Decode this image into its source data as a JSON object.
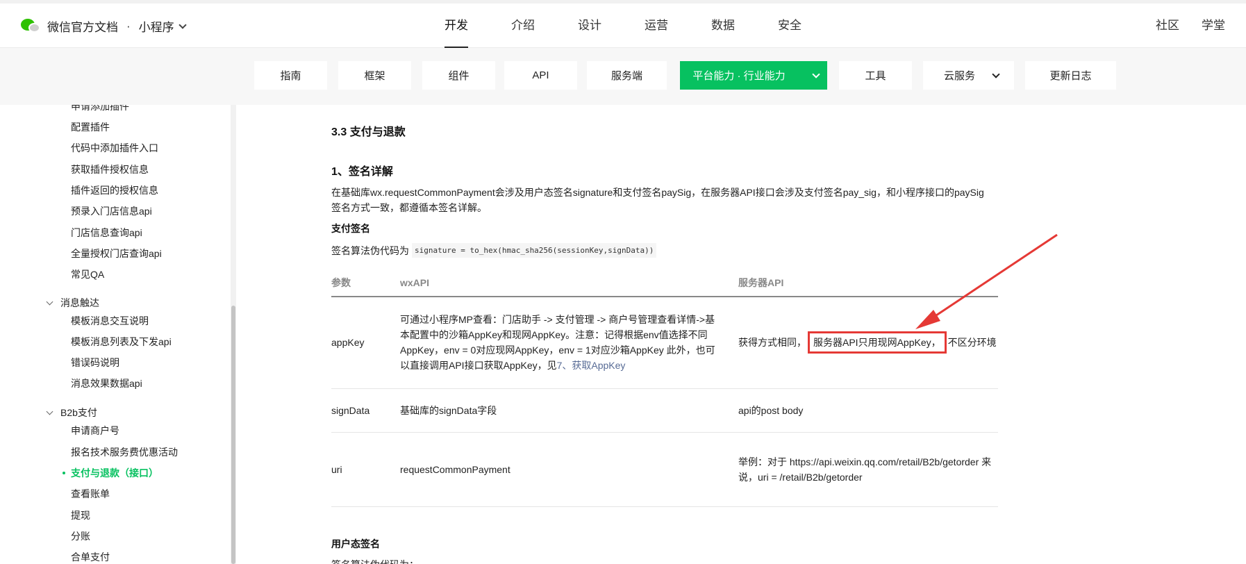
{
  "header": {
    "brand_title": "微信官方文档",
    "brand_dot": "·",
    "brand_sub": "小程序",
    "nav": [
      "开发",
      "介绍",
      "设计",
      "运营",
      "数据",
      "安全"
    ],
    "right_nav": [
      "社区",
      "学堂"
    ]
  },
  "subnav": {
    "tabs": [
      "指南",
      "框架",
      "组件",
      "API",
      "服务端",
      "平台能力 · 行业能力",
      "工具",
      "云服务",
      "更新日志"
    ],
    "active_tab": "平台能力 · 行业能力",
    "accent_color": "#07c160"
  },
  "sidebar": {
    "partial_top": "申请添加插件",
    "items_plugin": [
      "配置插件",
      "代码中添加插件入口",
      "获取插件授权信息",
      "插件返回的授权信息",
      "预录入门店信息api",
      "门店信息查询api",
      "全量授权门店查询api",
      "常见QA"
    ],
    "group_msg": "消息触达",
    "items_msg": [
      "模板消息交互说明",
      "模板消息列表及下发api",
      "错误码说明",
      "消息效果数据api"
    ],
    "group_b2b": "B2b支付",
    "items_b2b": [
      "申请商户号",
      "报名技术服务费优惠活动",
      "支付与退款（接口）",
      "查看账单",
      "提现",
      "分账",
      "合单支付"
    ],
    "active_item": "支付与退款（接口）"
  },
  "content": {
    "section_title": "3.3 支付与退款",
    "heading": "1、签名详解",
    "paragraph": "在基础库wx.requestCommonPayment会涉及用户态签名signature和支付签名paySig，在服务器API接口会涉及支付签名pay_sig，和小程序接口的paySig签名方式一致，都遵循本签名详解。",
    "pay_sign_label": "支付签名",
    "pseudo_label": "签名算法伪代码为",
    "pseudo_code": "signature = to_hex(hmac_sha256(sessionKey,signData))",
    "table": {
      "headers": [
        "参数",
        "wxAPI",
        "服务器API"
      ],
      "rows": [
        {
          "param": "appKey",
          "wx_text": "可通过小程序MP查看：门店助手 -> 支付管理 -> 商户号管理查看详情->基本配置中的沙箱AppKey和现网AppKey。注意：记得根据env值选择不同AppKey，env = 0对应现网AppKey，env = 1对应沙箱AppKey 此外，也可以直接调用API接口获取AppKey，见",
          "wx_link": "7、获取AppKey",
          "server_pre": "获得方式相同，",
          "server_highlight": "服务器API只用现网AppKey，",
          "server_post": "不区分环境"
        },
        {
          "param": "signData",
          "wx_text": "基础库的signData字段",
          "server": "api的post body"
        },
        {
          "param": "uri",
          "wx_text": "requestCommonPayment",
          "server": "举例：对于 https://api.weixin.qq.com/retail/B2b/getorder 来说，uri = /retail/B2b/getorder"
        }
      ]
    },
    "user_sign_label": "用户态签名",
    "cut_text": "签名算法伪代码为："
  },
  "annotation": {
    "color": "#e53935"
  }
}
